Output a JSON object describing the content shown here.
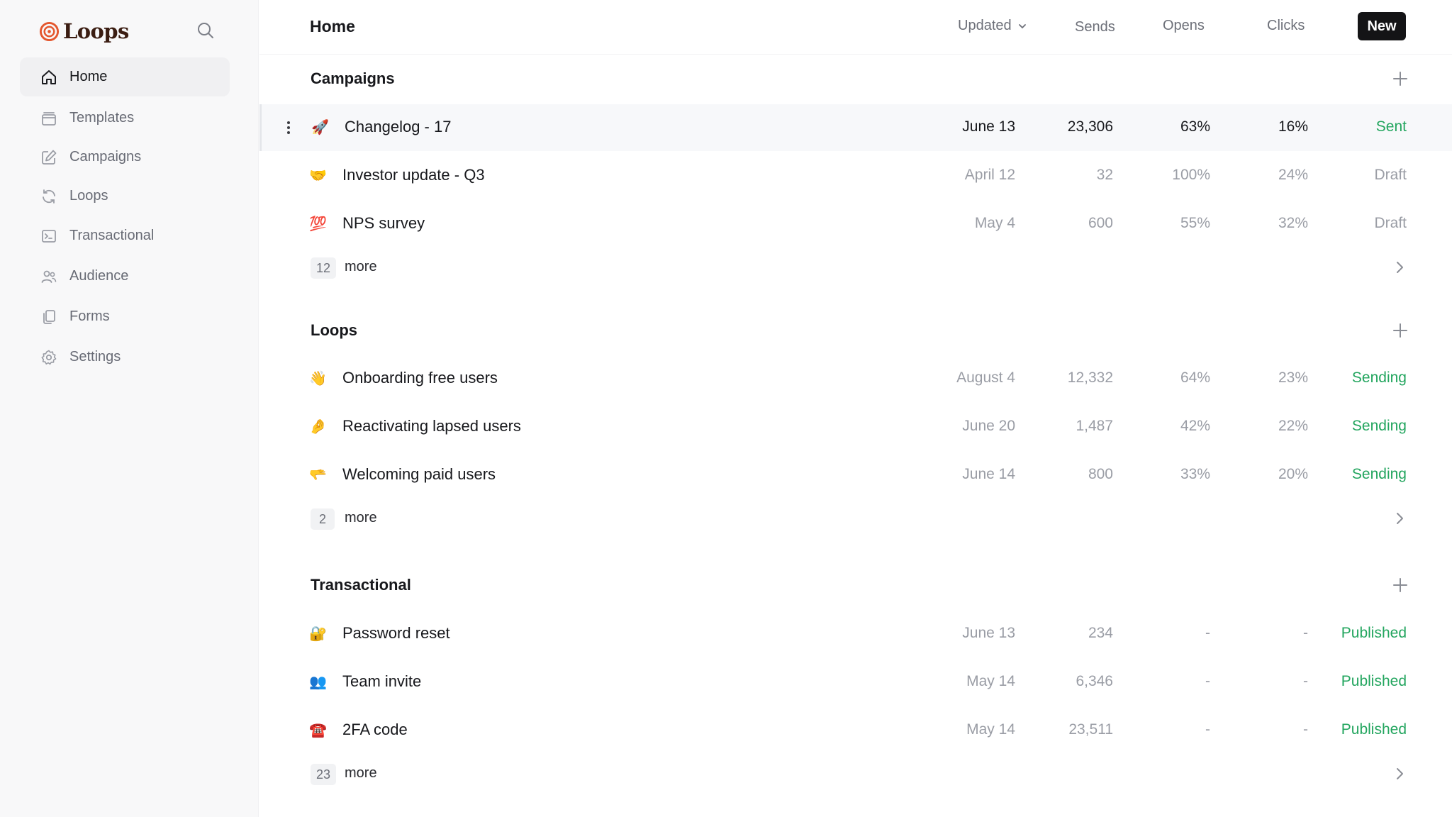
{
  "brand": {
    "name": "Loops",
    "color": "#e4572e"
  },
  "sidebar": {
    "items": [
      {
        "label": "Home",
        "icon": "home-icon",
        "active": true
      },
      {
        "label": "Templates",
        "icon": "template-icon"
      },
      {
        "label": "Campaigns",
        "icon": "edit-icon"
      },
      {
        "label": "Loops",
        "icon": "refresh-icon"
      },
      {
        "label": "Transactional",
        "icon": "terminal-icon"
      },
      {
        "label": "Audience",
        "icon": "users-icon"
      },
      {
        "label": "Forms",
        "icon": "copy-icon"
      },
      {
        "label": "Settings",
        "icon": "gear-icon"
      }
    ]
  },
  "header": {
    "title": "Home",
    "sort_label": "Updated",
    "columns": {
      "sends": "Sends",
      "opens": "Opens",
      "clicks": "Clicks"
    },
    "new_label": "New"
  },
  "sections": {
    "campaigns": {
      "title": "Campaigns",
      "rows": [
        {
          "emoji": "🚀",
          "name": "Changelog - 17",
          "date": "June 13",
          "sends": "23,306",
          "opens": "63%",
          "clicks": "16%",
          "status": "Sent"
        },
        {
          "emoji": "🤝",
          "name": "Investor update - Q3",
          "date": "April 12",
          "sends": "32",
          "opens": "100%",
          "clicks": "24%",
          "status": "Draft"
        },
        {
          "emoji": "💯",
          "name": "NPS survey",
          "date": "May 4",
          "sends": "600",
          "opens": "55%",
          "clicks": "32%",
          "status": "Draft"
        }
      ],
      "more_count": "12",
      "more_label": "more"
    },
    "loops": {
      "title": "Loops",
      "rows": [
        {
          "emoji": "👋",
          "name": "Onboarding free users",
          "date": "August 4",
          "sends": "12,332",
          "opens": "64%",
          "clicks": "23%",
          "status": "Sending"
        },
        {
          "emoji": "🤌",
          "name": "Reactivating lapsed users",
          "date": "June 20",
          "sends": "1,487",
          "opens": "42%",
          "clicks": "22%",
          "status": "Sending"
        },
        {
          "emoji": "🫳",
          "name": "Welcoming paid users",
          "date": "June 14",
          "sends": "800",
          "opens": "33%",
          "clicks": "20%",
          "status": "Sending"
        }
      ],
      "more_count": "2",
      "more_label": "more"
    },
    "transactional": {
      "title": "Transactional",
      "rows": [
        {
          "emoji": "🔐",
          "name": "Password reset",
          "date": "June 13",
          "sends": "234",
          "opens": "-",
          "clicks": "-",
          "status": "Published"
        },
        {
          "emoji": "👥",
          "name": "Team invite",
          "date": "May 14",
          "sends": "6,346",
          "opens": "-",
          "clicks": "-",
          "status": "Published"
        },
        {
          "emoji": "☎️",
          "name": "2FA code",
          "date": "May 14",
          "sends": "23,511",
          "opens": "-",
          "clicks": "-",
          "status": "Published"
        }
      ],
      "more_count": "23",
      "more_label": "more"
    }
  },
  "colors": {
    "status_green": "#22a55e",
    "muted": "#9a9da5",
    "button_dark": "#141416"
  }
}
